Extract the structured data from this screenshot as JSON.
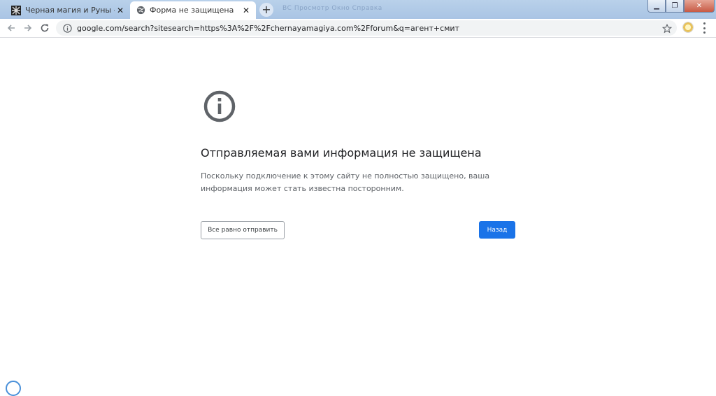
{
  "tabs": [
    {
      "title": "Черная магия и Руны - Главная",
      "favicon": "rune-icon",
      "active": false
    },
    {
      "title": "Форма не защищена",
      "favicon": "globe-icon",
      "active": true
    }
  ],
  "titlebar_menu": "ВС    Просмотр    Окно    Справка",
  "address_bar": {
    "url": "google.com/search?sitesearch=https%3A%2F%2Fchernayamagiya.com%2Fforum&q=агент+смит"
  },
  "page": {
    "icon": "info-icon",
    "heading": "Отправляемая вами информация не защищена",
    "description": "Поскольку подключение к этому сайту не полностью защищено, ваша информация может стать известна посторонним.",
    "send_anyway_label": "Все равно отправить",
    "back_label": "Назад"
  },
  "colors": {
    "primary_button": "#1a73e8",
    "heading_text": "#202124",
    "body_text": "#5f6368"
  }
}
